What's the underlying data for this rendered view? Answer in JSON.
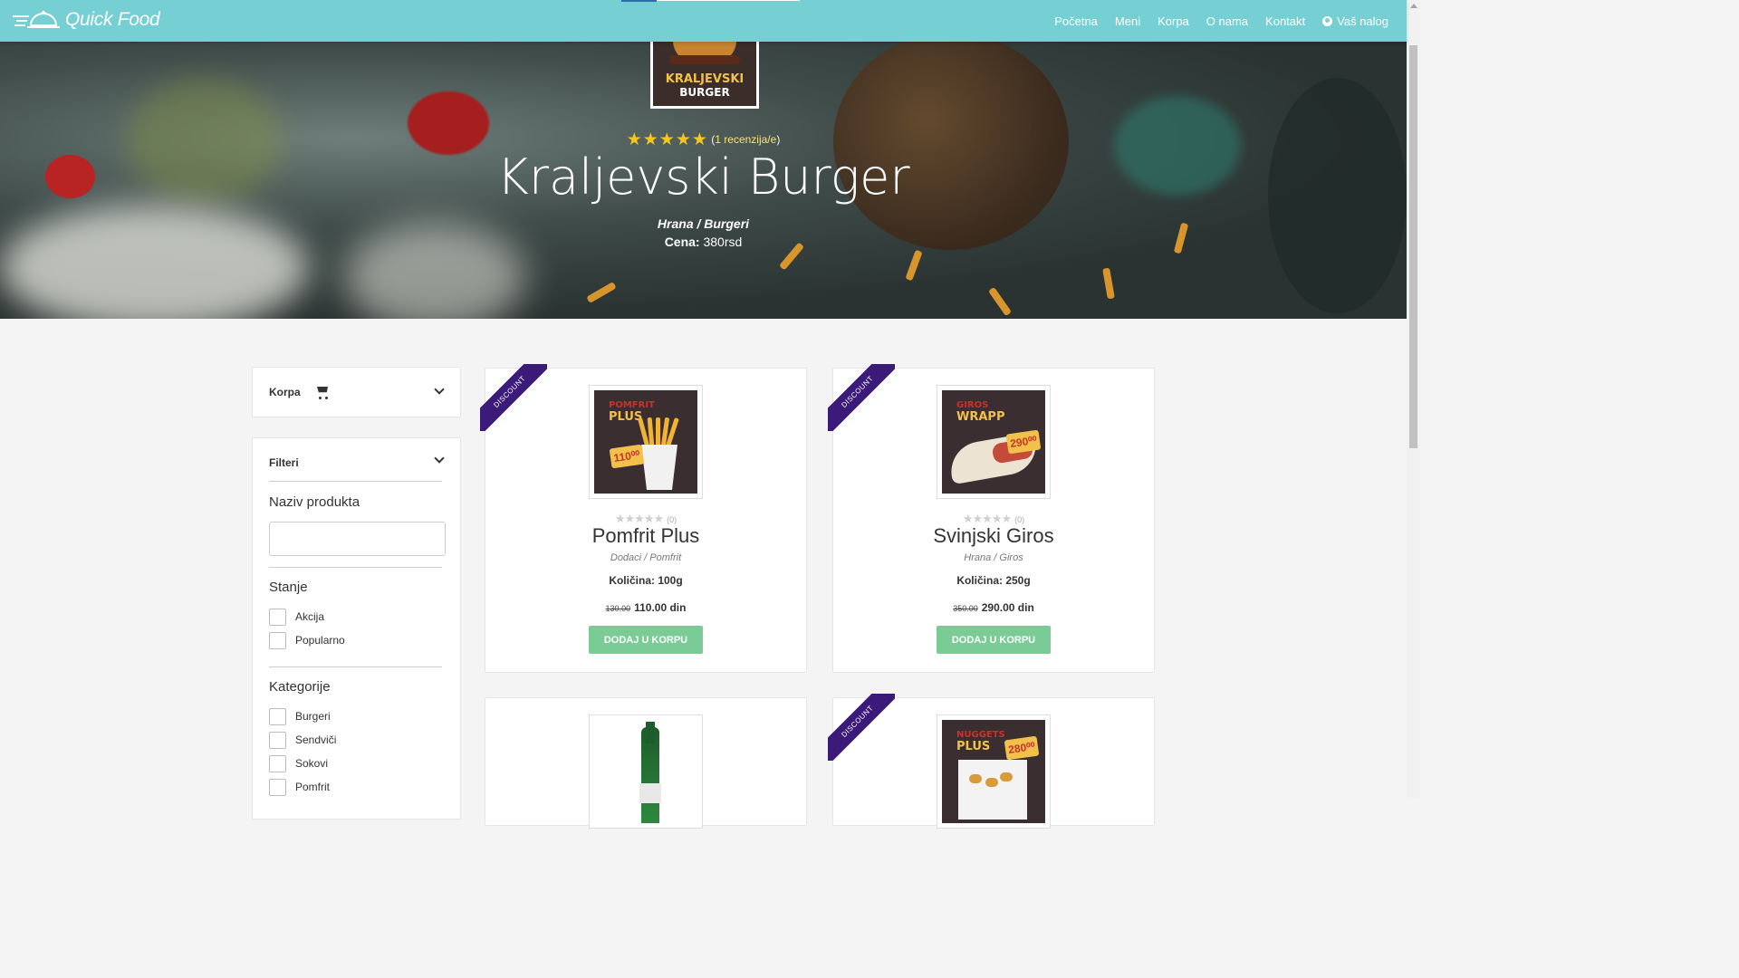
{
  "brand": {
    "name": "Quick Food"
  },
  "nav": {
    "items": [
      {
        "label": "Početna"
      },
      {
        "label": "Meni"
      },
      {
        "label": "Korpa"
      },
      {
        "label": "O nama"
      },
      {
        "label": "Kontakt"
      },
      {
        "label": "Vaš nalog"
      }
    ]
  },
  "hero": {
    "thumb_text_line1": "KRALJEVSKI",
    "thumb_text_line2": "BURGER",
    "rating": 5,
    "reviews_label": "1 recenzija/e",
    "reviews_open": "(",
    "reviews_close": ")",
    "title": "Kraljevski Burger",
    "category": "Hrana / Burgeri",
    "price_label": "Cena:",
    "price_value": "380rsd"
  },
  "sidebar": {
    "cart_title": "Korpa",
    "filters_title": "Filteri",
    "product_name_label": "Naziv produkta",
    "product_name_value": "",
    "status_title": "Stanje",
    "status_options": [
      "Akcija",
      "Popularno"
    ],
    "categories_title": "Kategorije",
    "categories": [
      "Burgeri",
      "Sendviči",
      "Sokovi",
      "Pomfrit"
    ]
  },
  "products": [
    {
      "name": "Pomfrit Plus",
      "category": "Dodaci / Pomfrit",
      "quantity": "Količina: 100g",
      "old_price": "130.00",
      "price": "110.00 din",
      "reviews": "(0)",
      "badge": "DISCOUNT",
      "button": "DODAJ U KORPU",
      "img_label_top": "POMFRIT",
      "img_label_main": "PLUS",
      "img_tag": "110⁰⁰"
    },
    {
      "name": "Svinjski Giros",
      "category": "Hrana / Giros",
      "quantity": "Količina: 250g",
      "old_price": "350.00",
      "price": "290.00 din",
      "reviews": "(0)",
      "badge": "DISCOUNT",
      "button": "DODAJ U KORPU",
      "img_label_top": "GIROS",
      "img_label_main": "WRAPP",
      "img_tag": "290⁰⁰"
    },
    {
      "name": "",
      "badge": ""
    },
    {
      "badge": "DISCOUNT",
      "img_label_top": "NUGGETS",
      "img_label_main": "PLUS",
      "img_tag": "280⁰⁰"
    }
  ],
  "colors": {
    "navbar": "#76d0d3",
    "button": "#7bcb97",
    "ribbon": "#3c1a7a",
    "star": "#f7c51b"
  }
}
